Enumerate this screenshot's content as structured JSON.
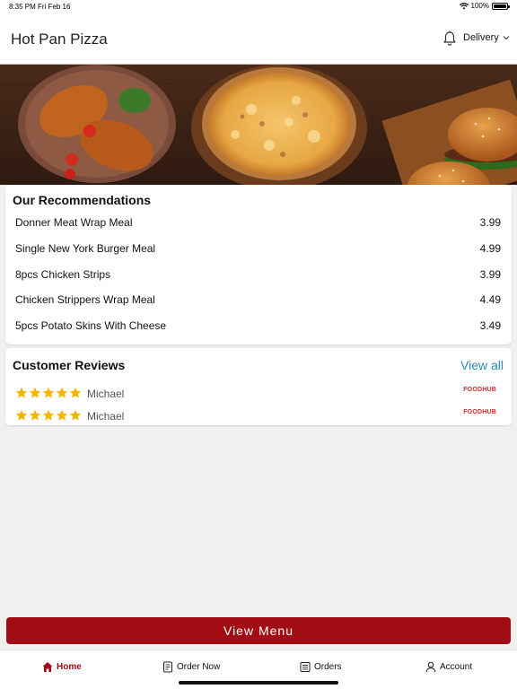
{
  "status_bar": {
    "time": "8:35 PM",
    "date": "Fri Feb 16",
    "battery": "100%",
    "battery_level": 1.0
  },
  "header": {
    "title": "Hot Pan Pizza",
    "delivery_mode": "Delivery"
  },
  "recommendations": {
    "title": "Our Recommendations",
    "items": [
      {
        "name": "Donner Meat Wrap Meal",
        "price": "3.99"
      },
      {
        "name": "Single New York Burger Meal",
        "price": "4.99"
      },
      {
        "name": "8pcs Chicken Strips",
        "price": "3.99"
      },
      {
        "name": "Chicken Strippers Wrap Meal",
        "price": "4.49"
      },
      {
        "name": "5pcs Potato Skins With Cheese",
        "price": "3.49"
      }
    ]
  },
  "reviews": {
    "title": "Customer Reviews",
    "view_all_label": "View all",
    "items": [
      {
        "reviewer": "Michael",
        "rating": 5,
        "source": "FOODHUB"
      },
      {
        "reviewer": "Michael",
        "rating": 5,
        "source": "FOODHUB"
      }
    ]
  },
  "actions": {
    "view_menu_label": "View Menu"
  },
  "tabs": [
    {
      "label": "Home",
      "icon": "home-icon",
      "active": true
    },
    {
      "label": "Order Now",
      "icon": "order-icon",
      "active": false
    },
    {
      "label": "Orders",
      "icon": "orders-icon",
      "active": false
    },
    {
      "label": "Account",
      "icon": "account-icon",
      "active": false
    }
  ],
  "colors": {
    "brand": "#a10d12",
    "link": "#2a8ab8",
    "star": "#f4b400"
  }
}
